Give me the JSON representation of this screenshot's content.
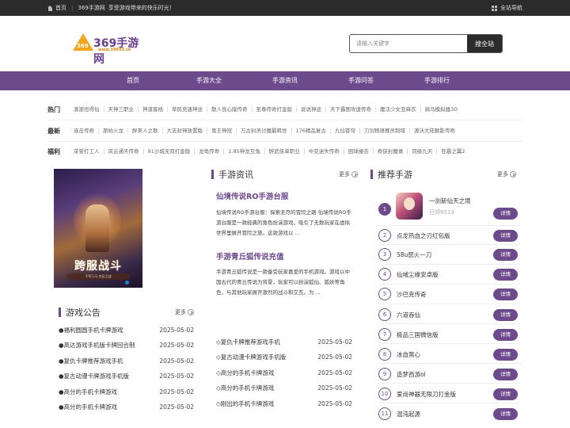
{
  "topbar": {
    "home": "首页",
    "site_name": "369手游网",
    "slogan": "享受游戏带来的快乐时光！",
    "site_nav": "全站导航"
  },
  "logo": {
    "name": "369手游网",
    "number": "369",
    "url": "www.39693.cn"
  },
  "search": {
    "placeholder": "请输入关键字",
    "button": "搜全站"
  },
  "nav": [
    "首页",
    "手游大全",
    "手游资讯",
    "手游问答",
    "手游排行"
  ],
  "tags": [
    {
      "label": "热门",
      "items": [
        "滚滚也得仙",
        "天神三职业",
        "神道客栈",
        "草民竞速神途",
        "散人良心版传奇",
        "至尊传奇打金版",
        "说说神途",
        "天下霸图攻速传奇",
        "魔法少女亚麻衣",
        "骑马模拟器3D"
      ]
    },
    {
      "label": "最新",
      "items": [
        "连击传奇",
        "原始火龙",
        "醉美人之歌",
        "大吉封神放置版",
        "鬼王神冠",
        "万古封灵讨魔最韩世",
        "176精品复古",
        "九仙苍穹",
        "刀剑物语赛灵制域",
        "源沃大陆魅影传奇"
      ]
    },
    {
      "label": "福利",
      "items": [
        "荣誉打工人",
        "风云通天传奇",
        "91沙城无双打金版",
        "龙龟传奇",
        "1.85神龙互兔",
        "醉武侠单职业",
        "中变迷失传奇",
        "困球撞击",
        "奇侠封魔录",
        "同级九天",
        "狂暴之翼2"
      ]
    }
  ],
  "banner": {
    "title": "跨服战斗",
    "subtitle": "千军万马 合区之战"
  },
  "announce": {
    "title": "游戏公告",
    "more": "更多",
    "items": [
      {
        "title": "●福利圆圆手机卡牌游戏",
        "date": "2025-05-02"
      },
      {
        "title": "●高达游戏手机版卡牌回合制",
        "date": "2025-05-02"
      },
      {
        "title": "●复仇卡牌推荐游戏手机",
        "date": "2025-05-02"
      },
      {
        "title": "●复古动漫卡牌游戏手机版",
        "date": "2025-05-02"
      },
      {
        "title": "●高分的手机卡牌游戏",
        "date": "2025-05-02"
      },
      {
        "title": "●高分的手机卡牌游戏",
        "date": "2025-05-02"
      }
    ]
  },
  "news": {
    "title": "手游资讯",
    "more": "更多",
    "articles": [
      {
        "title": "仙境传说RO手游台服",
        "desc": "仙境传说RO手游台服：探索无尽的冒险之路 仙境传说RO手游台服是一款经典的角色扮演游戏，吸引了无数玩家在虚拟世界里展开冒险之旅。这款游戏以 ..."
      },
      {
        "title": "手游青丘狐传说充值",
        "desc": "手游青丘狐传说是一款备受玩家喜爱的手机游戏。游戏以中国古代的青丘传说为背景，玩家可以扮演狐仙、狐妖等角色，与其他玩家展开激烈的战斗和交互。为 ..."
      }
    ],
    "list": [
      {
        "title": "◇复仇卡牌推荐游戏手机",
        "date": "2025-05-02"
      },
      {
        "title": "◇复古动漫卡牌游戏手机版",
        "date": "2025-05-02"
      },
      {
        "title": "◇高分的手机卡牌游戏",
        "date": "2025-05-02"
      },
      {
        "title": "◇高分的手机卡牌游戏",
        "date": "2025-05-02"
      },
      {
        "title": "◇刚出的手机卡牌游戏",
        "date": "2025-05-02"
      }
    ]
  },
  "recommend": {
    "title": "推荐手游",
    "more": "更多",
    "top": {
      "num": "1",
      "name": "一剑斩仙天之境",
      "count": "已领9513",
      "btn": "详情"
    },
    "items": [
      {
        "num": "2",
        "name": "点龙热血之刃红包版",
        "btn": "详情"
      },
      {
        "num": "3",
        "name": "58u怒火一刀",
        "btn": "详情"
      },
      {
        "num": "4",
        "name": "仙域尘缘安卓版",
        "btn": "详情"
      },
      {
        "num": "5",
        "name": "沙巴克传奇",
        "btn": "详情"
      },
      {
        "num": "6",
        "name": "六道吞仙",
        "btn": "详情"
      },
      {
        "num": "7",
        "name": "极品三国微信版",
        "btn": "详情"
      },
      {
        "num": "8",
        "name": "冰血煞心",
        "btn": "详情"
      },
      {
        "num": "9",
        "name": "造梦西游ol",
        "btn": "详情"
      },
      {
        "num": "10",
        "name": "爱尚神器无限刀打金版",
        "btn": "详情"
      },
      {
        "num": "11",
        "name": "混沌起源",
        "btn": "详情"
      }
    ]
  }
}
